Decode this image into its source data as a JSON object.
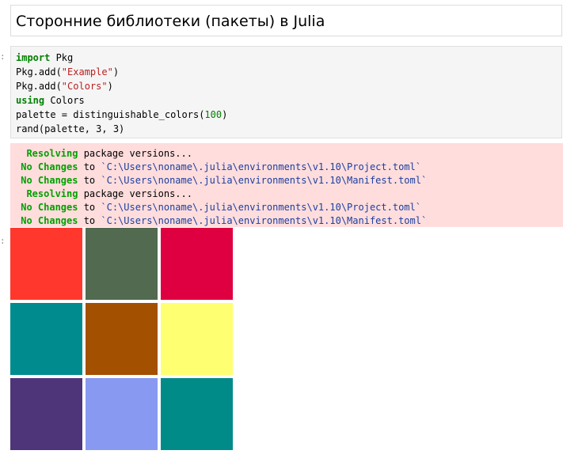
{
  "title_cell": {
    "heading": "Сторонние библиотеки (пакеты) в Julia"
  },
  "code_cell": {
    "prompt": ":",
    "lines": [
      [
        {
          "t": "kw",
          "v": "import"
        },
        {
          "t": "plain",
          "v": " Pkg"
        }
      ],
      [
        {
          "t": "plain",
          "v": "Pkg.add("
        },
        {
          "t": "str",
          "v": "\"Example\""
        },
        {
          "t": "plain",
          "v": ")"
        }
      ],
      [
        {
          "t": "plain",
          "v": "Pkg.add("
        },
        {
          "t": "str",
          "v": "\"Colors\""
        },
        {
          "t": "plain",
          "v": ")"
        }
      ],
      [
        {
          "t": "kw",
          "v": "using"
        },
        {
          "t": "plain",
          "v": " Colors"
        }
      ],
      [
        {
          "t": "plain",
          "v": "palette = distinguishable_colors("
        },
        {
          "t": "num",
          "v": "100"
        },
        {
          "t": "plain",
          "v": ")"
        }
      ],
      [
        {
          "t": "plain",
          "v": "rand(palette, 3, 3)"
        }
      ]
    ]
  },
  "stderr_output": {
    "lines": [
      {
        "status": "  Resolving",
        "rest": " package versions...",
        "path": ""
      },
      {
        "status": " No Changes",
        "rest": " to ",
        "path": "`C:\\Users\\noname\\.julia\\environments\\v1.10\\Project.toml`"
      },
      {
        "status": " No Changes",
        "rest": " to ",
        "path": "`C:\\Users\\noname\\.julia\\environments\\v1.10\\Manifest.toml`"
      },
      {
        "status": "  Resolving",
        "rest": " package versions...",
        "path": ""
      },
      {
        "status": " No Changes",
        "rest": " to ",
        "path": "`C:\\Users\\noname\\.julia\\environments\\v1.10\\Project.toml`"
      },
      {
        "status": " No Changes",
        "rest": " to ",
        "path": "`C:\\Users\\noname\\.julia\\environments\\v1.10\\Manifest.toml`"
      }
    ]
  },
  "result_output": {
    "prompt": ":",
    "grid_rows": 3,
    "grid_cols": 3,
    "swatches": [
      [
        "#ff372c",
        "#516a50",
        "#de0040"
      ],
      [
        "#008b8f",
        "#a35000",
        "#ffff72"
      ],
      [
        "#4e3579",
        "#8899f2",
        "#008b89"
      ]
    ]
  },
  "colors": {
    "code_background": "#f5f5f5",
    "stderr_background": "#ffdddd",
    "keyword": "#008000",
    "string": "#ba2121",
    "log_status": "#00a000",
    "log_path": "#1a3fa0"
  }
}
